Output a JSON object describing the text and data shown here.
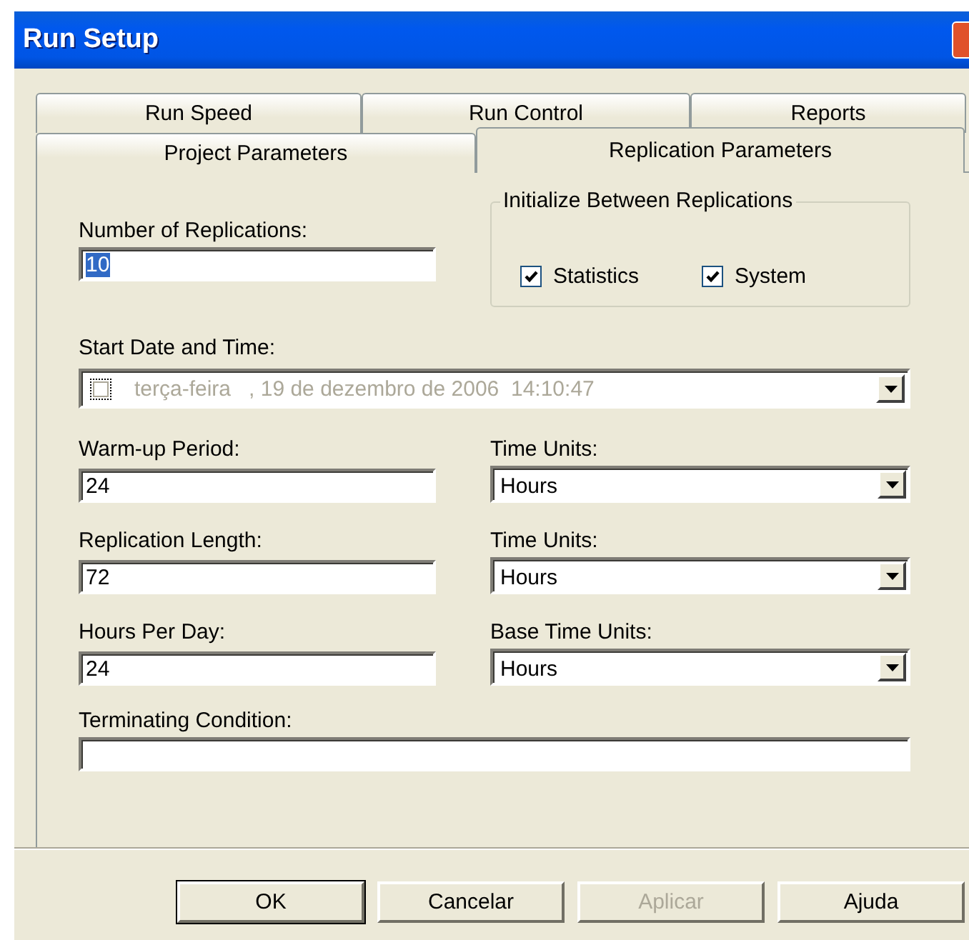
{
  "window": {
    "title": "Run Setup"
  },
  "tab_rows": [
    [
      {
        "label": "Run Speed",
        "selected": false
      },
      {
        "label": "Run Control",
        "selected": false
      },
      {
        "label": "Reports",
        "selected": false
      }
    ],
    [
      {
        "label": "Project Parameters",
        "selected": false
      },
      {
        "label": "Replication Parameters",
        "selected": true
      }
    ]
  ],
  "replications": {
    "label": "Number of Replications:",
    "value": "10",
    "value_selected": true
  },
  "initialize_group": {
    "title": "Initialize Between Replications",
    "options": [
      {
        "label": "Statistics",
        "checked": true
      },
      {
        "label": "System",
        "checked": true
      }
    ]
  },
  "start_date": {
    "label": "Start Date and Time:",
    "value": "terça-feira   , 19 de dezembro de 2006  14:10:47",
    "enabled": false,
    "checked": false
  },
  "rows": [
    {
      "label": "Warm-up Period:",
      "value": "24",
      "units": {
        "label": "Time Units:",
        "value": "Hours"
      }
    },
    {
      "label": "Replication Length:",
      "value": "72",
      "units": {
        "label": "Time Units:",
        "value": "Hours"
      }
    },
    {
      "label": "Hours Per Day:",
      "value": "24",
      "units": {
        "label": "Base Time Units:",
        "value": "Hours"
      }
    }
  ],
  "terminating_condition": {
    "label": "Terminating Condition:"
  },
  "buttons": [
    {
      "label": "OK",
      "default": true,
      "disabled": false
    },
    {
      "label": "Cancelar",
      "default": false,
      "disabled": false
    },
    {
      "label": "Aplicar",
      "default": false,
      "disabled": true
    },
    {
      "label": "Ajuda",
      "default": false,
      "disabled": false
    }
  ]
}
